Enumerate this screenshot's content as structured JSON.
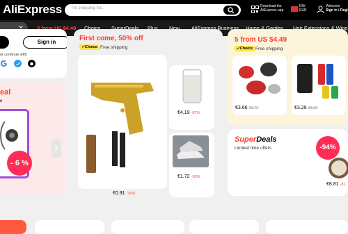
{
  "header": {
    "logo": "AliExpress",
    "search_placeholder": "I'm shopping for...",
    "download_line1": "Download the",
    "download_line2": "AliExpress app",
    "lang_line1": "EN/",
    "lang_line2": "EUR",
    "welcome_line1": "Welcome",
    "welcome_line2": "Sign in / Regi"
  },
  "nav": {
    "items": [
      {
        "label": "3 from US $4.49"
      },
      {
        "label": "Choice"
      },
      {
        "label": "SuperDeals"
      },
      {
        "label": "Plus"
      },
      {
        "label": "New"
      },
      {
        "label": "AliExpress Business"
      },
      {
        "label": "Home & Garden"
      },
      {
        "label": "Hair Extensions & Wigs"
      }
    ]
  },
  "welcome": {
    "signin_label": "Sign in",
    "continue_with": "or continue with"
  },
  "deal_left": {
    "title": "eal",
    "subtitle": "e",
    "discount": "- 6 %",
    "old_price": "15"
  },
  "choice": {
    "title": "First come, 50% off",
    "tag": "✓Choice",
    "shipping": "Free shipping",
    "products": [
      {
        "price": "€0.91",
        "discount": "-76%"
      },
      {
        "price": "€4.19",
        "discount": "-87%"
      },
      {
        "price": "€1.72",
        "discount": "-93%"
      }
    ]
  },
  "five": {
    "title": "5 from US $4.49",
    "tag": "✓Choice",
    "shipping": "Free shipping",
    "products": [
      {
        "price": "€3.66",
        "old": "€6.70"
      },
      {
        "price": "€3.29",
        "old": "€8.25"
      }
    ]
  },
  "super": {
    "title_a": "Super",
    "title_b": "Deals",
    "subtitle": "Limited time offers",
    "badge": "-94%",
    "price": "€8.81",
    "disc": "-81"
  },
  "colors": {
    "accent": "#ff3b30",
    "choice_yellow": "#ffe34f",
    "badge_pink": "#ff2d55"
  }
}
